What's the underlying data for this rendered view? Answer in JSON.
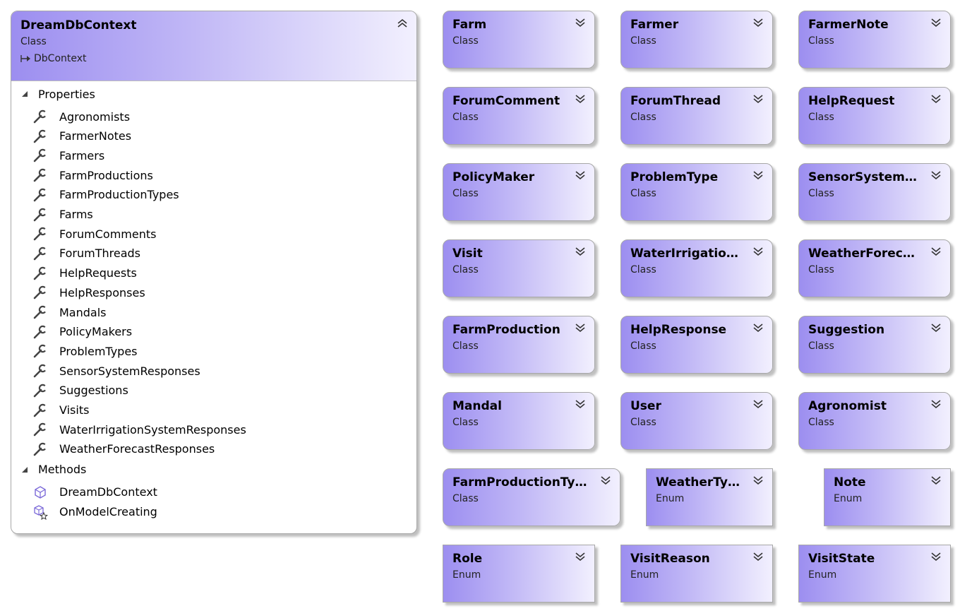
{
  "main_class": {
    "name": "DreamDbContext",
    "stereotype": "Class",
    "base": "DbContext",
    "properties_label": "Properties",
    "properties": [
      "Agronomists",
      "FarmerNotes",
      "Farmers",
      "FarmProductions",
      "FarmProductionTypes",
      "Farms",
      "ForumComments",
      "ForumThreads",
      "HelpRequests",
      "HelpResponses",
      "Mandals",
      "PolicyMakers",
      "ProblemTypes",
      "SensorSystemResponses",
      "Suggestions",
      "Visits",
      "WaterIrrigationSystemResponses",
      "WeatherForecastResponses"
    ],
    "methods_label": "Methods",
    "methods": [
      {
        "name": "DreamDbContext",
        "icon": "method-icon"
      },
      {
        "name": "OnModelCreating",
        "icon": "override-method-icon"
      }
    ]
  },
  "shapes": [
    {
      "name": "Farm",
      "kind": "Class"
    },
    {
      "name": "Farmer",
      "kind": "Class"
    },
    {
      "name": "FarmerNote",
      "kind": "Class"
    },
    {
      "name": "ForumComment",
      "kind": "Class"
    },
    {
      "name": "ForumThread",
      "kind": "Class"
    },
    {
      "name": "HelpRequest",
      "kind": "Class"
    },
    {
      "name": "PolicyMaker",
      "kind": "Class"
    },
    {
      "name": "ProblemType",
      "kind": "Class"
    },
    {
      "name": "SensorSystemRe...",
      "kind": "Class"
    },
    {
      "name": "Visit",
      "kind": "Class"
    },
    {
      "name": "WaterIrrigation...",
      "kind": "Class"
    },
    {
      "name": "WeatherForecas...",
      "kind": "Class"
    },
    {
      "name": "FarmProduction",
      "kind": "Class"
    },
    {
      "name": "HelpResponse",
      "kind": "Class"
    },
    {
      "name": "Suggestion",
      "kind": "Class"
    },
    {
      "name": "Mandal",
      "kind": "Class"
    },
    {
      "name": "User",
      "kind": "Class"
    },
    {
      "name": "Agronomist",
      "kind": "Class"
    },
    {
      "name": "FarmProductionType",
      "kind": "Class"
    },
    {
      "name": "WeatherType",
      "kind": "Enum"
    },
    {
      "name": "Note",
      "kind": "Enum"
    },
    {
      "name": "Role",
      "kind": "Enum"
    },
    {
      "name": "VisitReason",
      "kind": "Enum"
    },
    {
      "name": "VisitState",
      "kind": "Enum"
    }
  ],
  "colors": {
    "gradient_start": "#9c8ef0",
    "gradient_mid": "#c1b8f6",
    "gradient_end": "#f2f0fe",
    "border": "#a7a7a7"
  }
}
